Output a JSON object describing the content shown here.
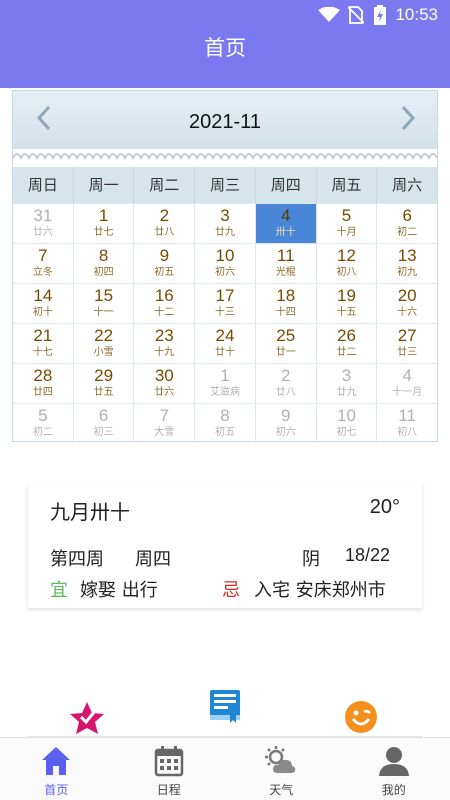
{
  "status_bar": {
    "time": "10:53"
  },
  "header": {
    "title": "首页"
  },
  "calendar": {
    "month_title": "2021-11",
    "weekdays": [
      "周日",
      "周一",
      "周二",
      "周三",
      "周四",
      "周五",
      "周六"
    ],
    "weeks": [
      [
        {
          "d": "31",
          "l": "廿六",
          "o": true
        },
        {
          "d": "1",
          "l": "廿七"
        },
        {
          "d": "2",
          "l": "廿八"
        },
        {
          "d": "3",
          "l": "廿九"
        },
        {
          "d": "4",
          "l": "卅十",
          "s": true
        },
        {
          "d": "5",
          "l": "十月"
        },
        {
          "d": "6",
          "l": "初二"
        }
      ],
      [
        {
          "d": "7",
          "l": "立冬"
        },
        {
          "d": "8",
          "l": "初四"
        },
        {
          "d": "9",
          "l": "初五"
        },
        {
          "d": "10",
          "l": "初六"
        },
        {
          "d": "11",
          "l": "光棍"
        },
        {
          "d": "12",
          "l": "初八"
        },
        {
          "d": "13",
          "l": "初九"
        }
      ],
      [
        {
          "d": "14",
          "l": "初十"
        },
        {
          "d": "15",
          "l": "十一"
        },
        {
          "d": "16",
          "l": "十二"
        },
        {
          "d": "17",
          "l": "十三"
        },
        {
          "d": "18",
          "l": "十四"
        },
        {
          "d": "19",
          "l": "十五"
        },
        {
          "d": "20",
          "l": "十六"
        }
      ],
      [
        {
          "d": "21",
          "l": "十七"
        },
        {
          "d": "22",
          "l": "小雪"
        },
        {
          "d": "23",
          "l": "十九"
        },
        {
          "d": "24",
          "l": "廿十"
        },
        {
          "d": "25",
          "l": "廿一"
        },
        {
          "d": "26",
          "l": "廿二"
        },
        {
          "d": "27",
          "l": "廿三"
        }
      ],
      [
        {
          "d": "28",
          "l": "廿四"
        },
        {
          "d": "29",
          "l": "廿五"
        },
        {
          "d": "30",
          "l": "廿六"
        },
        {
          "d": "1",
          "l": "艾滋病",
          "o": true
        },
        {
          "d": "2",
          "l": "廿八",
          "o": true
        },
        {
          "d": "3",
          "l": "廿九",
          "o": true
        },
        {
          "d": "4",
          "l": "十一月",
          "o": true
        }
      ],
      [
        {
          "d": "5",
          "l": "初二",
          "o": true
        },
        {
          "d": "6",
          "l": "初三",
          "o": true
        },
        {
          "d": "7",
          "l": "大雪",
          "o": true
        },
        {
          "d": "8",
          "l": "初五",
          "o": true
        },
        {
          "d": "9",
          "l": "初六",
          "o": true
        },
        {
          "d": "10",
          "l": "初七",
          "o": true
        },
        {
          "d": "11",
          "l": "初八",
          "o": true
        }
      ]
    ]
  },
  "info": {
    "lunar_date": "九月卅十",
    "temperature": "20°",
    "week_number": "第四周",
    "weekday": "周四",
    "weather": "阴",
    "temp_range": "18/22",
    "yi_label": "宜",
    "yi_text": "嫁娶  出行",
    "ji_label": "忌",
    "ji_text": "入宅  安床郑州市"
  },
  "colors": {
    "accent": "#7b79f0",
    "selected_day": "#4a86d8",
    "yi": "#5cb85c",
    "ji": "#c9302c"
  },
  "shortcuts": [
    "star-icon",
    "book-icon",
    "smile-icon"
  ],
  "tabs": [
    {
      "label": "首页",
      "icon": "home-icon"
    },
    {
      "label": "日程",
      "icon": "calendar-icon"
    },
    {
      "label": "天气",
      "icon": "weather-icon"
    },
    {
      "label": "我的",
      "icon": "user-icon"
    }
  ]
}
